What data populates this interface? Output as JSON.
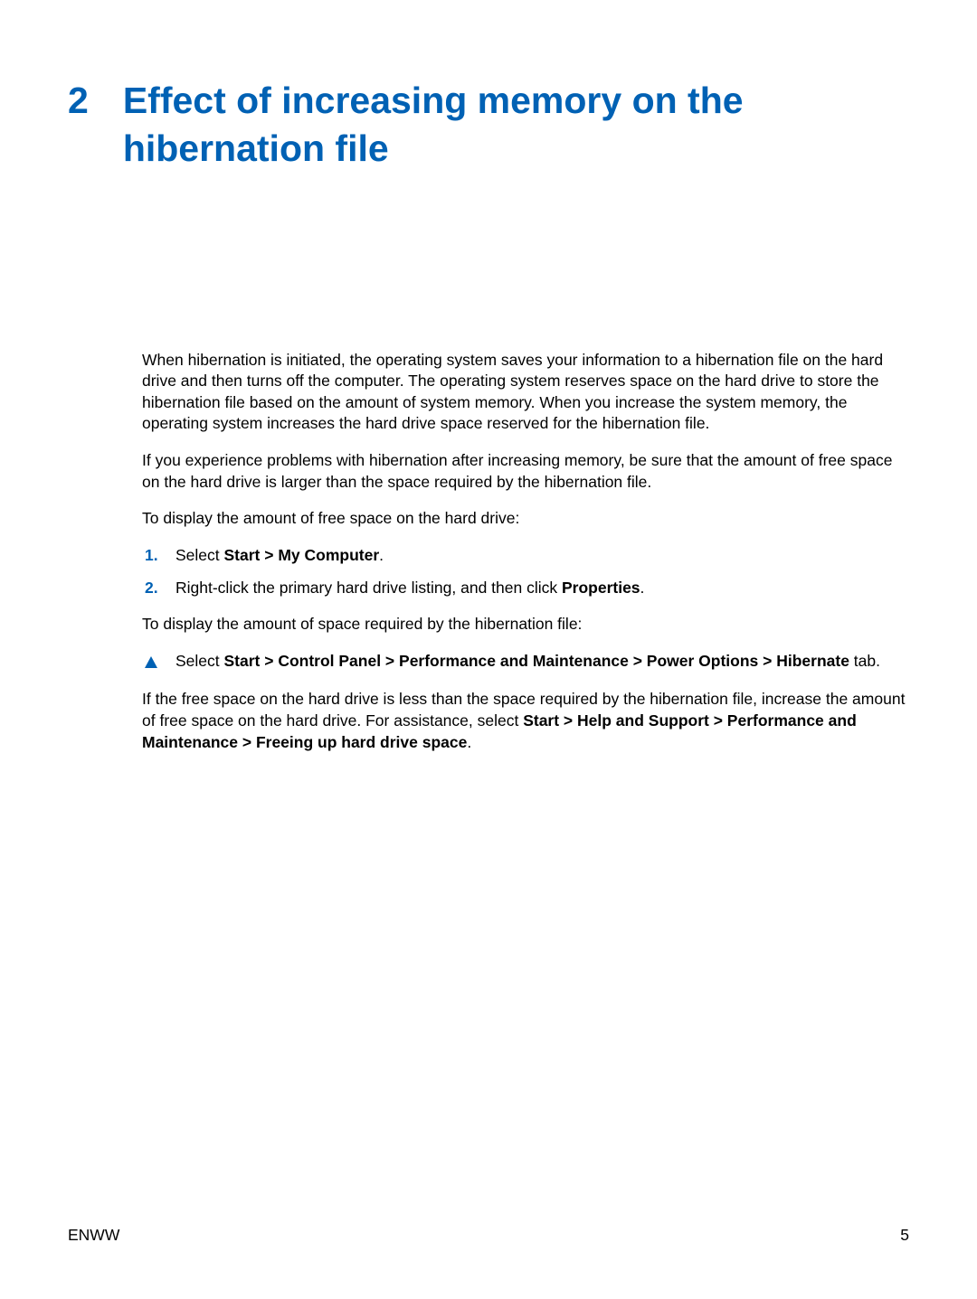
{
  "chapter": {
    "number": "2",
    "title": "Effect of increasing memory on the hibernation file"
  },
  "paragraphs": {
    "p1": "When hibernation is initiated, the operating system saves your information to a hibernation file on the hard drive and then turns off the computer. The operating system reserves space on the hard drive to store the hibernation file based on the amount of system memory. When you increase the system memory, the operating system increases the hard drive space reserved for the hibernation file.",
    "p2": "If you experience problems with hibernation after increasing memory, be sure that the amount of free space on the hard drive is larger than the space required by the hibernation file.",
    "p3": "To display the amount of free space on the hard drive:",
    "p4": "To display the amount of space required by the hibernation file:",
    "p5_pre": "If the free space on the hard drive is less than the space required by the hibernation file, increase the amount of free space on the hard drive. For assistance, select ",
    "p5_bold": "Start > Help and Support > Performance and Maintenance > Freeing up hard drive space",
    "p5_post": "."
  },
  "steps": {
    "s1": {
      "marker": "1.",
      "pre": "Select ",
      "bold": "Start > My Computer",
      "post": "."
    },
    "s2": {
      "marker": "2.",
      "pre": "Right-click the primary hard drive listing, and then click ",
      "bold": "Properties",
      "post": "."
    },
    "triangle": {
      "pre": "Select ",
      "bold": "Start > Control Panel > Performance and Maintenance > Power Options > Hibernate",
      "post": " tab."
    }
  },
  "footer": {
    "left": "ENWW",
    "right": "5"
  }
}
